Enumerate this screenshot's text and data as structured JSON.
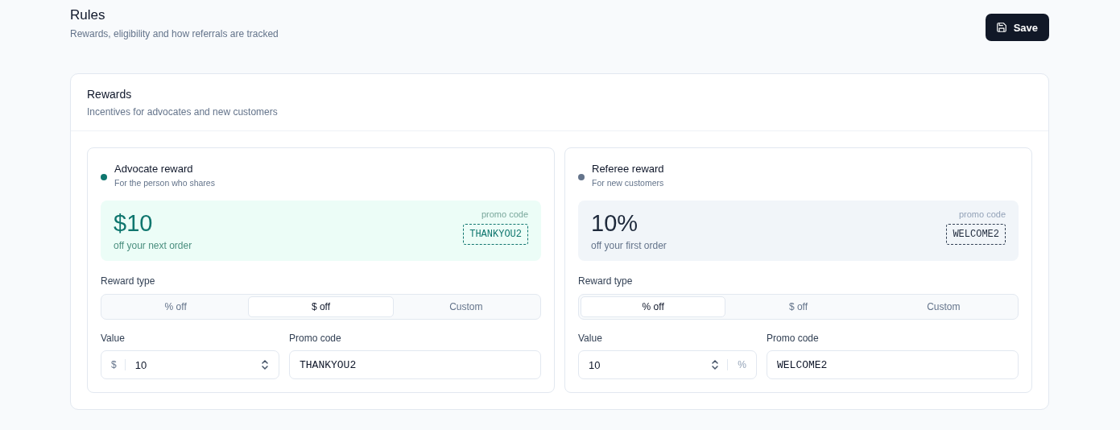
{
  "header": {
    "title": "Rules",
    "subtitle": "Rewards, eligibility and how referrals are tracked",
    "save_button": "Save"
  },
  "rewards_card": {
    "title": "Rewards",
    "subtitle": "Incentives for advocates and new customers",
    "rewards": [
      {
        "title": "Advocate reward",
        "subtitle": "For the person who shares",
        "color": "#0f766e",
        "kind": "advocate",
        "amount": "$10",
        "amount_caption": "off your next order",
        "promo_label": "promo code",
        "promo_code": "THANKYOU2",
        "type_label": "Reward type",
        "types": [
          {
            "label": "% off",
            "selected": false
          },
          {
            "label": "$ off",
            "selected": true
          },
          {
            "label": "Custom",
            "selected": false
          }
        ],
        "value_label": "Value",
        "value": "10",
        "unit": "$",
        "code_label": "Promo code",
        "code_value": "THANKYOU2"
      },
      {
        "title": "Referee reward",
        "subtitle": "For new customers",
        "color": "#64748b",
        "kind": "referee",
        "amount": "10%",
        "amount_caption": "off your first order",
        "promo_label": "promo code",
        "promo_code": "WELCOME2",
        "type_label": "Reward type",
        "types": [
          {
            "label": "% off",
            "selected": true
          },
          {
            "label": "$ off",
            "selected": false
          },
          {
            "label": "Custom",
            "selected": false
          }
        ],
        "value_label": "Value",
        "value": "10",
        "unit": "%",
        "code_label": "Promo code",
        "code_value": "WELCOME2"
      }
    ]
  }
}
